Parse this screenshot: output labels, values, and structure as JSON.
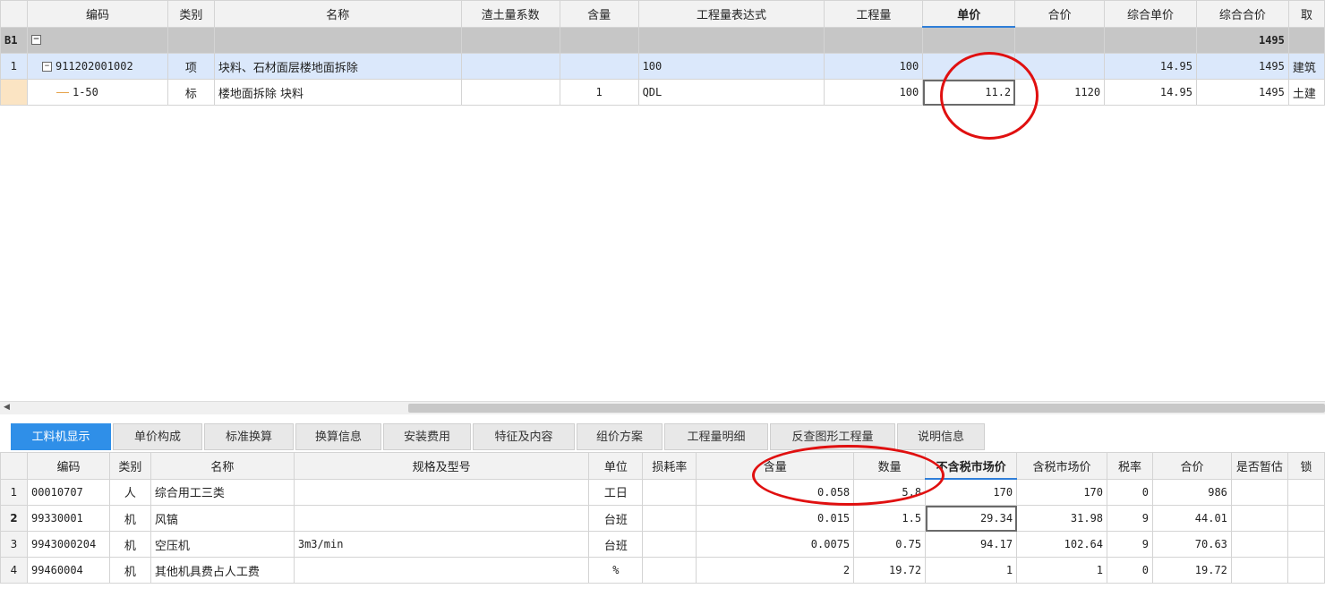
{
  "top_table": {
    "columns": [
      "编码",
      "类别",
      "名称",
      "渣土量系数",
      "含量",
      "工程量表达式",
      "工程量",
      "单价",
      "合价",
      "综合单价",
      "综合合价",
      "取"
    ],
    "group": {
      "code": "B1",
      "total": "1495"
    },
    "rows": [
      {
        "rownum": "1",
        "code": "911202001002",
        "type": "项",
        "name": "块料、石材面层楼地面拆除",
        "coef": "",
        "content": "",
        "expr": "100",
        "qty": "100",
        "price": "",
        "sum": "",
        "unit_price": "14.95",
        "total": "1495",
        "extra": "建筑"
      },
      {
        "rownum": "",
        "code": "1-50",
        "type": "标",
        "name": "楼地面拆除 块料",
        "coef": "",
        "content": "1",
        "expr": "QDL",
        "qty": "100",
        "price": "11.2",
        "sum": "1120",
        "unit_price": "14.95",
        "total": "1495",
        "extra": "土建"
      }
    ]
  },
  "scrollbar": {
    "left_arrow": "◀"
  },
  "tabs": [
    "工料机显示",
    "单价构成",
    "标准换算",
    "换算信息",
    "安装费用",
    "特征及内容",
    "组价方案",
    "工程量明细",
    "反查图形工程量",
    "说明信息"
  ],
  "bottom_table": {
    "columns": [
      "编码",
      "类别",
      "名称",
      "规格及型号",
      "单位",
      "损耗率",
      "含量",
      "数量",
      "不含税市场价",
      "含税市场价",
      "税率",
      "合价",
      "是否暂估",
      "锁"
    ],
    "rows": [
      {
        "rownum": "1",
        "code": "00010707",
        "type": "人",
        "name": "综合用工三类",
        "spec": "",
        "unit": "工日",
        "loss": "",
        "content": "0.058",
        "qty": "5.8",
        "price": "170",
        "tax_price": "170",
        "rate": "0",
        "sum": "986"
      },
      {
        "rownum": "2",
        "code": "99330001",
        "type": "机",
        "name": "风镐",
        "spec": "",
        "unit": "台班",
        "loss": "",
        "content": "0.015",
        "qty": "1.5",
        "price": "29.34",
        "tax_price": "31.98",
        "rate": "9",
        "sum": "44.01"
      },
      {
        "rownum": "3",
        "code": "9943000204",
        "type": "机",
        "name": "空压机",
        "spec": "3m3/min",
        "unit": "台班",
        "loss": "",
        "content": "0.0075",
        "qty": "0.75",
        "price": "94.17",
        "tax_price": "102.64",
        "rate": "9",
        "sum": "70.63"
      },
      {
        "rownum": "4",
        "code": "99460004",
        "type": "机",
        "name": "其他机具费占人工费",
        "spec": "",
        "unit": "%",
        "loss": "",
        "content": "2",
        "qty": "19.72",
        "price": "1",
        "tax_price": "1",
        "rate": "0",
        "sum": "19.72"
      }
    ]
  },
  "colors": {
    "highlight": "#e01010",
    "active_tab": "#2f8fe8",
    "group_row": "#c6c6c6",
    "selected_row": "#dbe8fb"
  }
}
